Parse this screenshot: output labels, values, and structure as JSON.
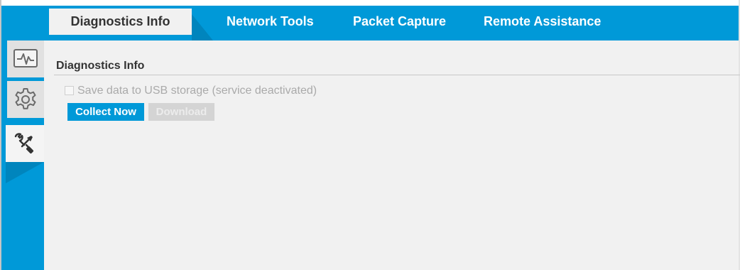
{
  "tabs": [
    {
      "label": "Diagnostics Info",
      "active": true
    },
    {
      "label": "Network Tools",
      "active": false
    },
    {
      "label": "Packet Capture",
      "active": false
    },
    {
      "label": "Remote Assistance",
      "active": false
    }
  ],
  "sidebar": {
    "items": [
      {
        "icon": "activity-monitor-icon",
        "active": false
      },
      {
        "icon": "gear-icon",
        "active": false
      },
      {
        "icon": "tools-icon",
        "active": true
      }
    ]
  },
  "section": {
    "title": "Diagnostics Info"
  },
  "usb_option": {
    "label": "Save data to USB storage (service deactivated)",
    "checked": false,
    "disabled": true
  },
  "buttons": {
    "collect_label": "Collect Now",
    "download_label": "Download",
    "download_disabled": true
  },
  "colors": {
    "accent": "#0099d8",
    "content_bg": "#f1f1f1",
    "disabled_button": "#d4d4d4"
  }
}
